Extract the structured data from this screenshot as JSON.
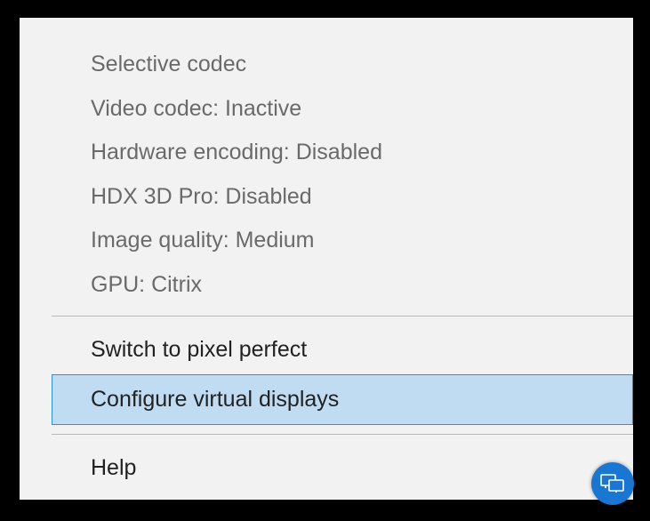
{
  "menu": {
    "info": [
      {
        "label": "Selective codec"
      },
      {
        "label": "Video codec: Inactive"
      },
      {
        "label": "Hardware encoding: Disabled"
      },
      {
        "label": "HDX 3D Pro: Disabled"
      },
      {
        "label": "Image quality: Medium"
      },
      {
        "label": "GPU: Citrix"
      }
    ],
    "actions": {
      "pixel_perfect": "Switch to pixel perfect",
      "virtual_displays": "Configure virtual displays",
      "help": "Help"
    }
  }
}
